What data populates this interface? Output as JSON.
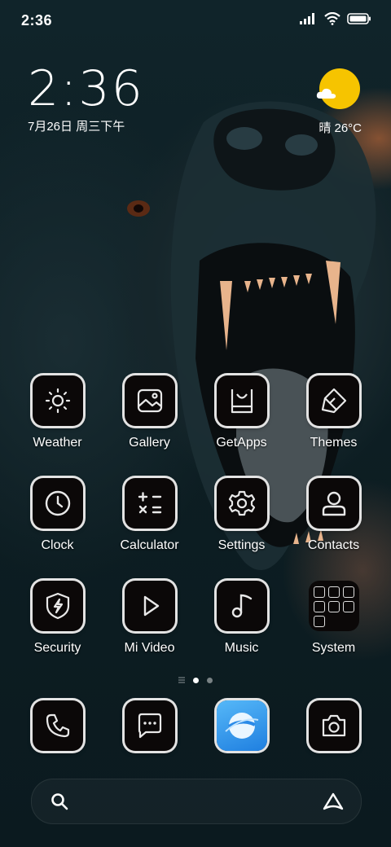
{
  "status_bar": {
    "time": "2:36"
  },
  "clock_widget": {
    "time": "2:36",
    "date": "7月26日 周三下午"
  },
  "weather_widget": {
    "text": "晴 26°C",
    "icon": "sunny-cloud-icon"
  },
  "apps": [
    {
      "label": "Weather",
      "icon": "sun-icon"
    },
    {
      "label": "Gallery",
      "icon": "image-icon"
    },
    {
      "label": "GetApps",
      "icon": "store-icon"
    },
    {
      "label": "Themes",
      "icon": "paint-bucket-icon"
    },
    {
      "label": "Clock",
      "icon": "clock-icon"
    },
    {
      "label": "Calculator",
      "icon": "calculator-icon"
    },
    {
      "label": "Settings",
      "icon": "gear-icon"
    },
    {
      "label": "Contacts",
      "icon": "person-icon"
    },
    {
      "label": "Security",
      "icon": "shield-bolt-icon"
    },
    {
      "label": "Mi Video",
      "icon": "play-icon"
    },
    {
      "label": "Music",
      "icon": "music-note-icon"
    },
    {
      "label": "System",
      "icon": "folder-icon"
    }
  ],
  "page_indicator": {
    "pages": 2,
    "current": 1
  },
  "dock": [
    {
      "icon": "phone-icon"
    },
    {
      "icon": "message-icon"
    },
    {
      "icon": "browser-icon"
    },
    {
      "icon": "camera-icon"
    }
  ],
  "search_bar": {
    "left_icon": "search-icon",
    "right_icon": "assistant-icon"
  }
}
